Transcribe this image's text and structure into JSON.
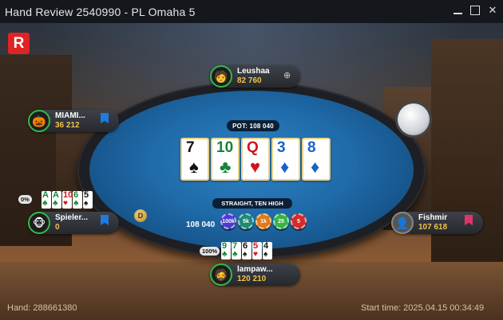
{
  "window": {
    "title": "Hand Review 2540990 - PL Omaha 5",
    "buttons": {
      "minimize": "minimize",
      "maximize": "maximize",
      "close": "✕"
    }
  },
  "brand": {
    "logo_letter": "R",
    "logo_color": "#e02323"
  },
  "table": {
    "pot_label": "POT: 108 040",
    "board": [
      {
        "rank": "7",
        "suit": "♠",
        "color": "black"
      },
      {
        "rank": "10",
        "suit": "♣",
        "color": "green"
      },
      {
        "rank": "Q",
        "suit": "♥",
        "color": "red"
      },
      {
        "rank": "3",
        "suit": "♦",
        "color": "blue"
      },
      {
        "rank": "8",
        "suit": "♦",
        "color": "blue"
      }
    ],
    "hand_label": "STRAIGHT, TEN HIGH",
    "bet_amount": "108 040",
    "chips": [
      {
        "label": "100k",
        "color": "#4c3bd1"
      },
      {
        "label": "5k",
        "color": "#1f8a7a"
      },
      {
        "label": "1k",
        "color": "#e07a1a"
      },
      {
        "label": "25",
        "color": "#3ab34a"
      },
      {
        "label": "5",
        "color": "#d22c2c"
      }
    ],
    "dealer_button": "D"
  },
  "players": {
    "top": {
      "name": "Leushaa",
      "stack": "82 760",
      "plus_icon": "⊕"
    },
    "left_top": {
      "name": "MIAMI...",
      "stack": "36 212"
    },
    "left_bottom": {
      "name": "Spieler...",
      "stack": "0",
      "equity": "0%",
      "cards": [
        {
          "r": "A",
          "s": "♣",
          "c": "green"
        },
        {
          "r": "A",
          "s": "♣",
          "c": "green"
        },
        {
          "r": "10",
          "s": "♥",
          "c": "red"
        },
        {
          "r": "6",
          "s": "♣",
          "c": "green"
        },
        {
          "r": "5",
          "s": "♠",
          "c": "black"
        }
      ]
    },
    "right": {
      "name": "Fishmir",
      "stack": "107 618"
    },
    "hero": {
      "name": "lampaw...",
      "stack": "120 210",
      "equity": "100%",
      "cards": [
        {
          "r": "9",
          "s": "♣",
          "c": "green"
        },
        {
          "r": "7",
          "s": "♣",
          "c": "green"
        },
        {
          "r": "6",
          "s": "♠",
          "c": "black"
        },
        {
          "r": "5",
          "s": "♥",
          "c": "red"
        },
        {
          "r": "4",
          "s": "♠",
          "c": "black"
        }
      ]
    }
  },
  "footer": {
    "hand": "Hand: 288661380",
    "start_time": "Start time: 2025.04.15 00:34:49"
  }
}
